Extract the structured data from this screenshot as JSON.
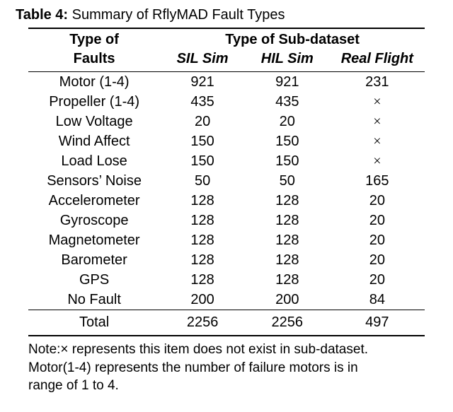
{
  "caption_bold": "Table 4:",
  "caption_rest": " Summary of RflyMAD Fault Types",
  "header": {
    "type_of": "Type of",
    "faults": "Faults",
    "type_of_sub": "Type of Sub-dataset",
    "cols": [
      "SIL Sim",
      "HIL Sim",
      "Real Flight"
    ]
  },
  "x_mark": "×",
  "rows": [
    {
      "label": "Motor (1-4)",
      "sil": "921",
      "hil": "921",
      "real": "231"
    },
    {
      "label": "Propeller (1-4)",
      "sil": "435",
      "hil": "435",
      "real": "×"
    },
    {
      "label": "Low Voltage",
      "sil": "20",
      "hil": "20",
      "real": "×"
    },
    {
      "label": "Wind Affect",
      "sil": "150",
      "hil": "150",
      "real": "×"
    },
    {
      "label": "Load Lose",
      "sil": "150",
      "hil": "150",
      "real": "×"
    },
    {
      "label": "Sensors’ Noise",
      "sil": "50",
      "hil": "50",
      "real": "165"
    },
    {
      "label": "Accelerometer",
      "sil": "128",
      "hil": "128",
      "real": "20"
    },
    {
      "label": "Gyroscope",
      "sil": "128",
      "hil": "128",
      "real": "20"
    },
    {
      "label": "Magnetometer",
      "sil": "128",
      "hil": "128",
      "real": "20"
    },
    {
      "label": "Barometer",
      "sil": "128",
      "hil": "128",
      "real": "20"
    },
    {
      "label": "GPS",
      "sil": "128",
      "hil": "128",
      "real": "20"
    },
    {
      "label": "No Fault",
      "sil": "200",
      "hil": "200",
      "real": "84"
    }
  ],
  "total": {
    "label": "Total",
    "sil": "2256",
    "hil": "2256",
    "real": "497"
  },
  "note_l1": "Note:× represents this item does not exist in sub-dataset.",
  "note_l2": "Motor(1-4) represents the number of failure motors is in",
  "note_l3": "range of 1 to 4.",
  "chart_data": {
    "type": "table",
    "title": "Summary of RflyMAD Fault Types",
    "columns": [
      "Type of Faults",
      "SIL Sim",
      "HIL Sim",
      "Real Flight"
    ],
    "rows": [
      [
        "Motor (1-4)",
        921,
        921,
        231
      ],
      [
        "Propeller (1-4)",
        435,
        435,
        null
      ],
      [
        "Low Voltage",
        20,
        20,
        null
      ],
      [
        "Wind Affect",
        150,
        150,
        null
      ],
      [
        "Load Lose",
        150,
        150,
        null
      ],
      [
        "Sensors’ Noise",
        50,
        50,
        165
      ],
      [
        "Accelerometer",
        128,
        128,
        20
      ],
      [
        "Gyroscope",
        128,
        128,
        20
      ],
      [
        "Magnetometer",
        128,
        128,
        20
      ],
      [
        "Barometer",
        128,
        128,
        20
      ],
      [
        "GPS",
        128,
        128,
        20
      ],
      [
        "No Fault",
        200,
        200,
        84
      ]
    ],
    "totals": [
      "Total",
      2256,
      2256,
      497
    ],
    "legend_note": "× = not present in sub-dataset"
  }
}
